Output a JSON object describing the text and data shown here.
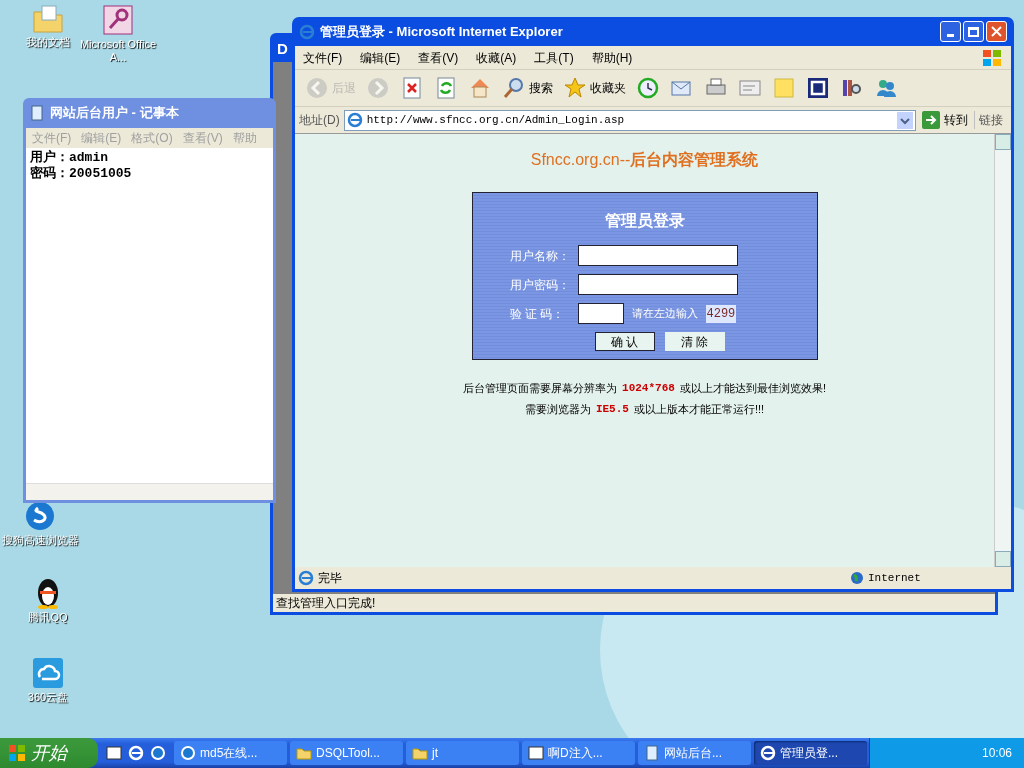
{
  "desktop_icons": [
    {
      "label": "我的文档",
      "kind": "folder"
    },
    {
      "label": "Microsoft Office A...",
      "kind": "access"
    },
    {
      "label": "搜狗高速浏览器",
      "kind": "browser"
    },
    {
      "label": "腾讯QQ",
      "kind": "penguin"
    },
    {
      "label": "360云盘",
      "kind": "cloud"
    }
  ],
  "background_window": {
    "title": "D",
    "status": "查找管理入口完成!"
  },
  "notepad": {
    "title": "网站后台用户 - 记事本",
    "menu": [
      "文件(F)",
      "编辑(E)",
      "格式(O)",
      "查看(V)",
      "帮助"
    ],
    "lines": [
      "用户：admin",
      "密码：20051005"
    ]
  },
  "browser": {
    "title": "管理员登录 - Microsoft Internet Explorer",
    "menu": [
      "文件(F)",
      "编辑(E)",
      "查看(V)",
      "收藏(A)",
      "工具(T)",
      "帮助(H)"
    ],
    "toolbar": [
      {
        "kind": "back",
        "label": "后退",
        "disabled": true
      },
      {
        "kind": "forward",
        "disabled": true
      },
      {
        "kind": "stop",
        "disabled": false
      },
      {
        "kind": "refresh",
        "disabled": false
      },
      {
        "kind": "home",
        "disabled": false
      },
      {
        "kind": "search",
        "label": "搜索",
        "disabled": false
      },
      {
        "kind": "favorites",
        "label": "收藏夹",
        "disabled": false
      },
      {
        "kind": "history",
        "disabled": false
      },
      {
        "kind": "mail",
        "disabled": false
      },
      {
        "kind": "print",
        "disabled": false
      },
      {
        "kind": "edit",
        "disabled": false
      },
      {
        "kind": "note",
        "disabled": false
      },
      {
        "kind": "square",
        "disabled": false
      },
      {
        "kind": "books",
        "disabled": false
      },
      {
        "kind": "people",
        "disabled": false
      }
    ],
    "address": {
      "label": "地址(D)",
      "url": "http://www.sfncc.org.cn/Admin_Login.asp",
      "go": "转到",
      "links": "链接"
    },
    "page": {
      "site_title": "Sfncc.org.cn--**后台内容管理系统**",
      "login": {
        "title": "管理员登录",
        "fields": [
          {
            "label": "用户名称：",
            "kind": "text"
          },
          {
            "label": "用户密码：",
            "kind": "text"
          },
          {
            "label": "验 证 码：",
            "kind": "captcha",
            "hint": "请在左边输入",
            "code": "4299"
          }
        ],
        "buttons": [
          "确 认",
          "清 除"
        ]
      },
      "notes": [
        {
          "before": "后台管理页面需要屏幕分辨率为",
          "highlight": "1024*768",
          "after": "或以上才能达到最佳浏览效果!"
        },
        {
          "before": "需要浏览器为",
          "highlight": "IE5.5",
          "after": "或以上版本才能正常运行!!!"
        }
      ]
    },
    "status": {
      "text": "完毕",
      "zone": "Internet"
    }
  },
  "taskbar": {
    "start": "开始",
    "tasks": [
      {
        "label": "md5在线...",
        "kind": "browser",
        "selected": false
      },
      {
        "label": "DSQLTool...",
        "kind": "folder",
        "selected": false
      },
      {
        "label": "jt",
        "kind": "folder",
        "selected": false
      },
      {
        "label": "啊D注入...",
        "kind": "app",
        "selected": false
      },
      {
        "label": "网站后台...",
        "kind": "notepad",
        "selected": false
      },
      {
        "label": "管理员登...",
        "kind": "ie",
        "selected": true
      }
    ],
    "clock": "10:06"
  }
}
